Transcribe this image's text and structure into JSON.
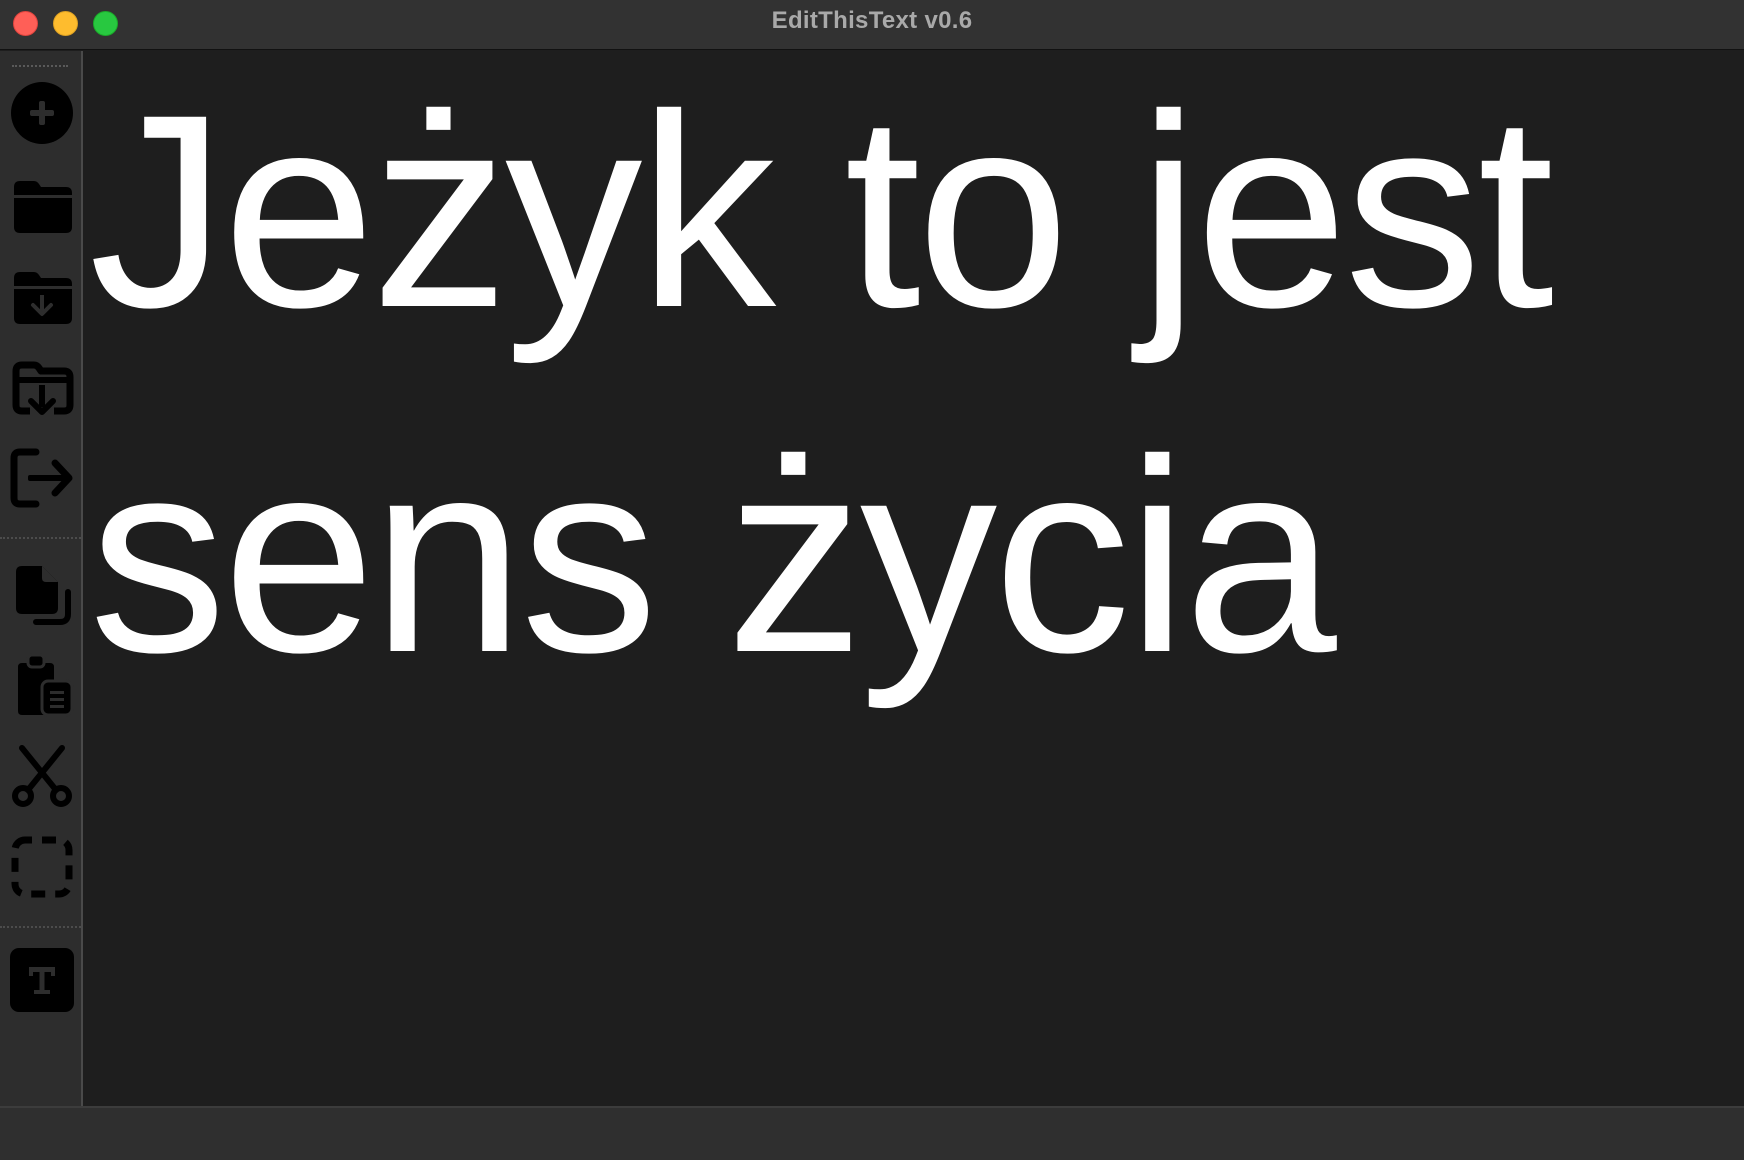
{
  "window": {
    "title": "EditThisText v0.6",
    "controls": [
      "close",
      "minimize",
      "maximize"
    ]
  },
  "toolbar": {
    "tools": [
      {
        "name": "new",
        "icon": "plus-circle-icon"
      },
      {
        "name": "open",
        "icon": "folder-icon"
      },
      {
        "name": "save",
        "icon": "folder-download-icon"
      },
      {
        "name": "save-as",
        "icon": "folder-save-as-icon"
      },
      {
        "name": "export",
        "icon": "export-arrow-icon"
      },
      {
        "name": "copy",
        "icon": "copy-icon"
      },
      {
        "name": "paste",
        "icon": "clipboard-icon"
      },
      {
        "name": "cut",
        "icon": "scissors-icon"
      },
      {
        "name": "select-all",
        "icon": "dashed-selection-icon"
      },
      {
        "name": "font",
        "icon": "text-format-icon"
      }
    ]
  },
  "editor": {
    "content": "Jeżyk to jest sens życia",
    "text_color": "#ffffff",
    "background_color": "#1e1e1e"
  },
  "colors": {
    "close": "#ff5f57",
    "minimize": "#febc2e",
    "maximize": "#28c840",
    "titlebar": "#323232",
    "sidebar": "#2d2d2d"
  }
}
